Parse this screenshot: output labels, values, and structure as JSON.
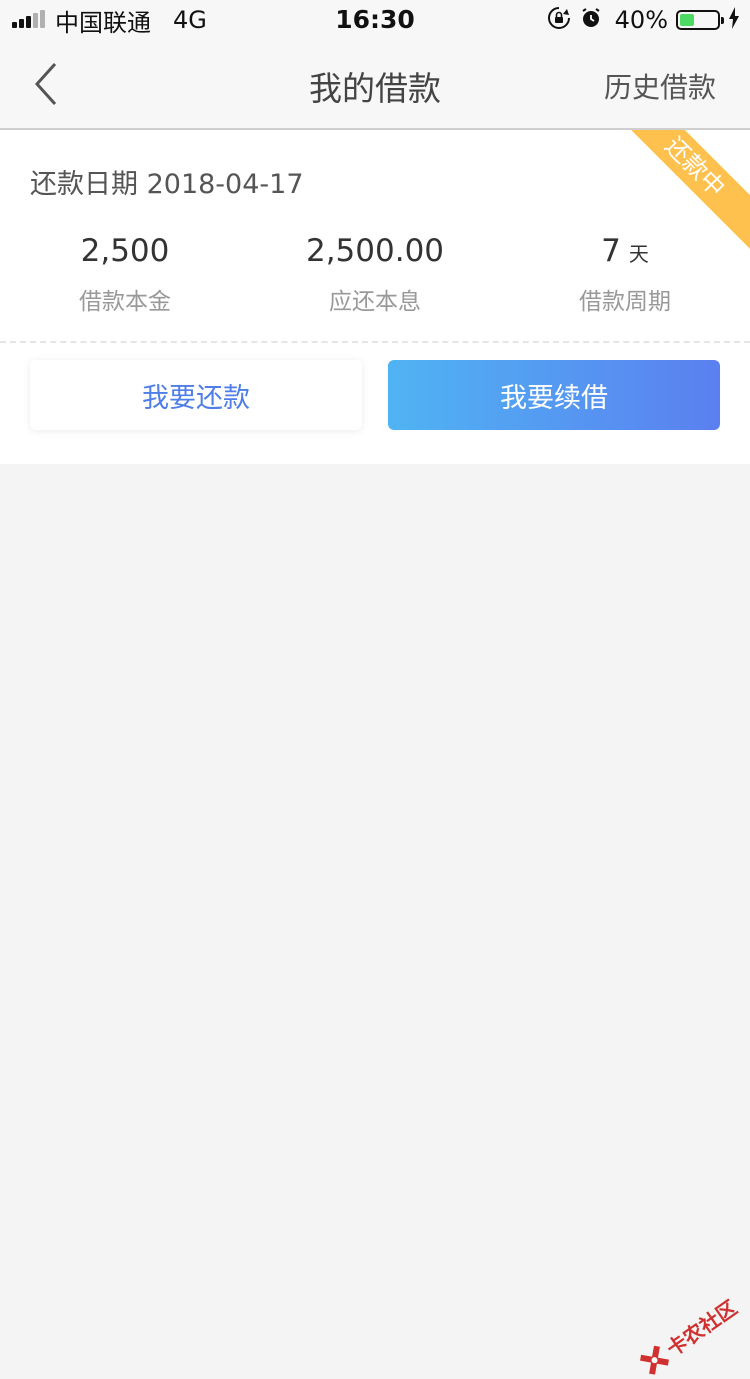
{
  "status_bar": {
    "carrier": "中国联通",
    "network": "4G",
    "time": "16:30",
    "battery": "40%",
    "battery_level": 0.4
  },
  "nav": {
    "title": "我的借款",
    "history": "历史借款"
  },
  "loan": {
    "status_ribbon": "还款中",
    "due_date_label": "还款日期 2018-04-17",
    "principal": {
      "value": "2,500",
      "label": "借款本金"
    },
    "amount_due": {
      "value": "2,500.00",
      "label": "应还本息"
    },
    "period": {
      "value": "7",
      "unit": "天",
      "label": "借款周期"
    }
  },
  "actions": {
    "repay": "我要还款",
    "renew": "我要续借"
  },
  "watermark": {
    "text": "卡农社区"
  },
  "colors": {
    "accent": "#4f7ee8",
    "ribbon": "#ffc14d",
    "gradient_start": "#4fb4f3",
    "gradient_end": "#5b7ff0",
    "battery": "#4cd964"
  }
}
